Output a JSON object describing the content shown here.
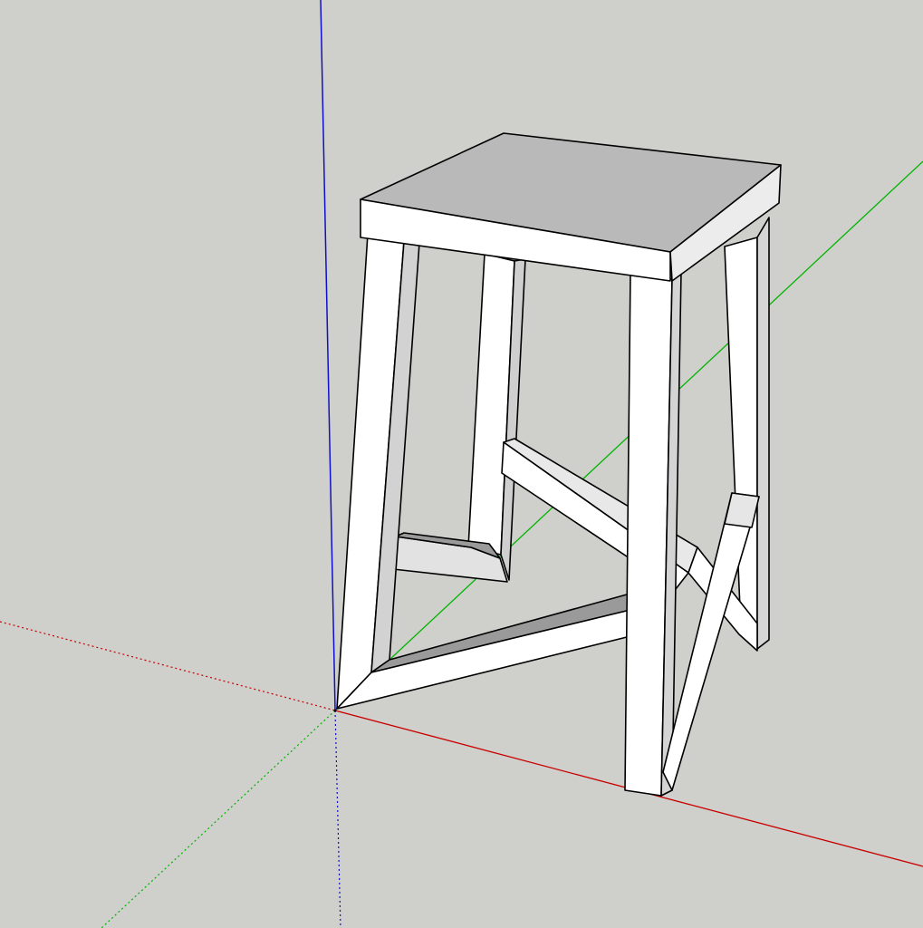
{
  "colors": {
    "background": "#cfcfcb",
    "axis_red": "#c80000",
    "axis_green": "#00b400",
    "axis_blue": "#1010c8",
    "face_light": "#ffffff",
    "face_shade": "#b9b9b9",
    "face_mid": "#e4e4e4",
    "edge": "#000000"
  },
  "model": {
    "name": "stool",
    "parts": [
      "seat-top",
      "seat-front",
      "seat-right",
      "leg-back-left",
      "leg-back-right",
      "leg-front-left",
      "leg-front-right",
      "stretcher-front",
      "stretcher-right",
      "stretcher-back",
      "stretcher-left"
    ]
  },
  "axes": [
    "red-axis",
    "green-axis",
    "blue-axis"
  ]
}
